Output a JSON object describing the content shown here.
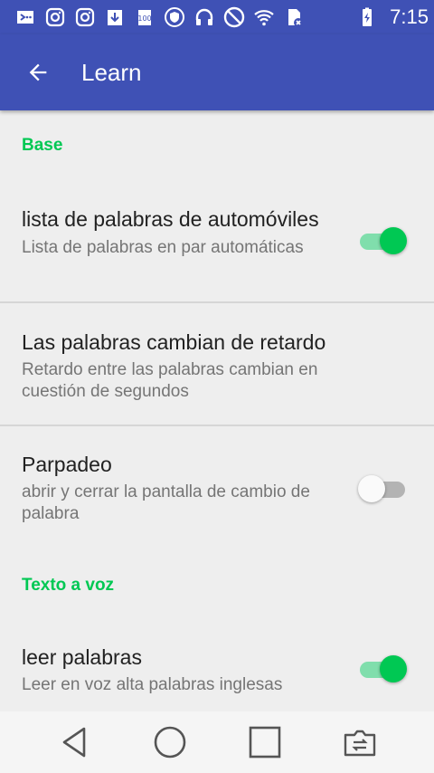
{
  "status_bar": {
    "time": "7:15",
    "icons": [
      "notification-icon",
      "instagram-icon",
      "instagram-icon",
      "download-icon",
      "battery-saver-icon",
      "vpn-shield-icon",
      "headphones-icon",
      "do-not-disturb-icon",
      "wifi-icon",
      "sim-card-icon",
      "battery-charging-icon"
    ]
  },
  "app_bar": {
    "title": "Learn",
    "background": "#3f51b5"
  },
  "sections": {
    "base": "Base",
    "tts": "Texto a voz"
  },
  "prefs": {
    "auto_list": {
      "title": "lista de palabras de automóviles",
      "summary": "Lista de palabras en par automáticas",
      "enabled": true
    },
    "delay": {
      "title": "Las palabras cambian de retardo",
      "summary": "Retardo entre las palabras cambian en cuestión de segundos"
    },
    "blink": {
      "title": "Parpadeo",
      "summary": "abrir y cerrar la pantalla de cambio de palabra",
      "enabled": false
    },
    "read_words": {
      "title": "leer palabras",
      "summary": "Leer en voz alta palabras inglesas",
      "enabled": true
    }
  },
  "colors": {
    "accent": "#00c853",
    "primary": "#3f51b5"
  },
  "nav_bar": {
    "buttons": [
      "back-triangle-icon",
      "home-circle-icon",
      "recents-square-icon",
      "switch-app-icon"
    ]
  }
}
